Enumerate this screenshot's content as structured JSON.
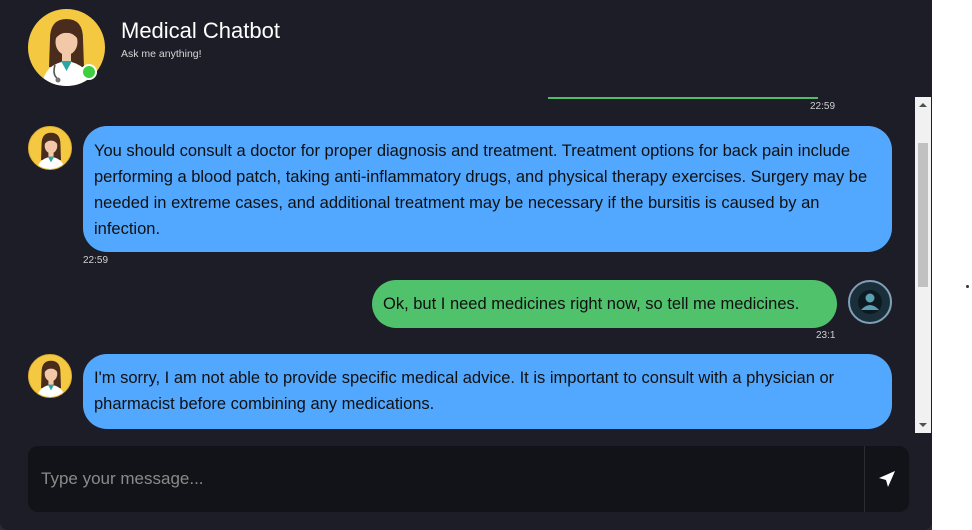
{
  "header": {
    "title": "Medical Chatbot",
    "subtitle": "Ask me anything!",
    "avatar_icon": "doctor-avatar-icon",
    "status": "online"
  },
  "messages": [
    {
      "sender": "user",
      "text": "",
      "time": "22:59"
    },
    {
      "sender": "bot",
      "text": "You should consult a doctor for proper diagnosis and treatment. Treatment options for back pain include performing a blood patch, taking anti-inflammatory drugs, and physical therapy exercises. Surgery may be needed in extreme cases, and additional treatment may be necessary if the bursitis is caused by an infection.",
      "time": "22:59"
    },
    {
      "sender": "user",
      "text": "Ok, but I need medicines right now, so tell me medicines.",
      "time": "23:1"
    },
    {
      "sender": "bot",
      "text": "I'm sorry, I am not able to provide specific medical advice. It is important to consult with a physician or pharmacist before combining any medications.",
      "time": ""
    }
  ],
  "composer": {
    "placeholder": "Type your message...",
    "send_icon": "send-icon"
  },
  "colors": {
    "bot_bubble": "#52a8ff",
    "user_bubble": "#4fc26b",
    "background": "#1c1d26",
    "online": "#3ecf3e"
  }
}
